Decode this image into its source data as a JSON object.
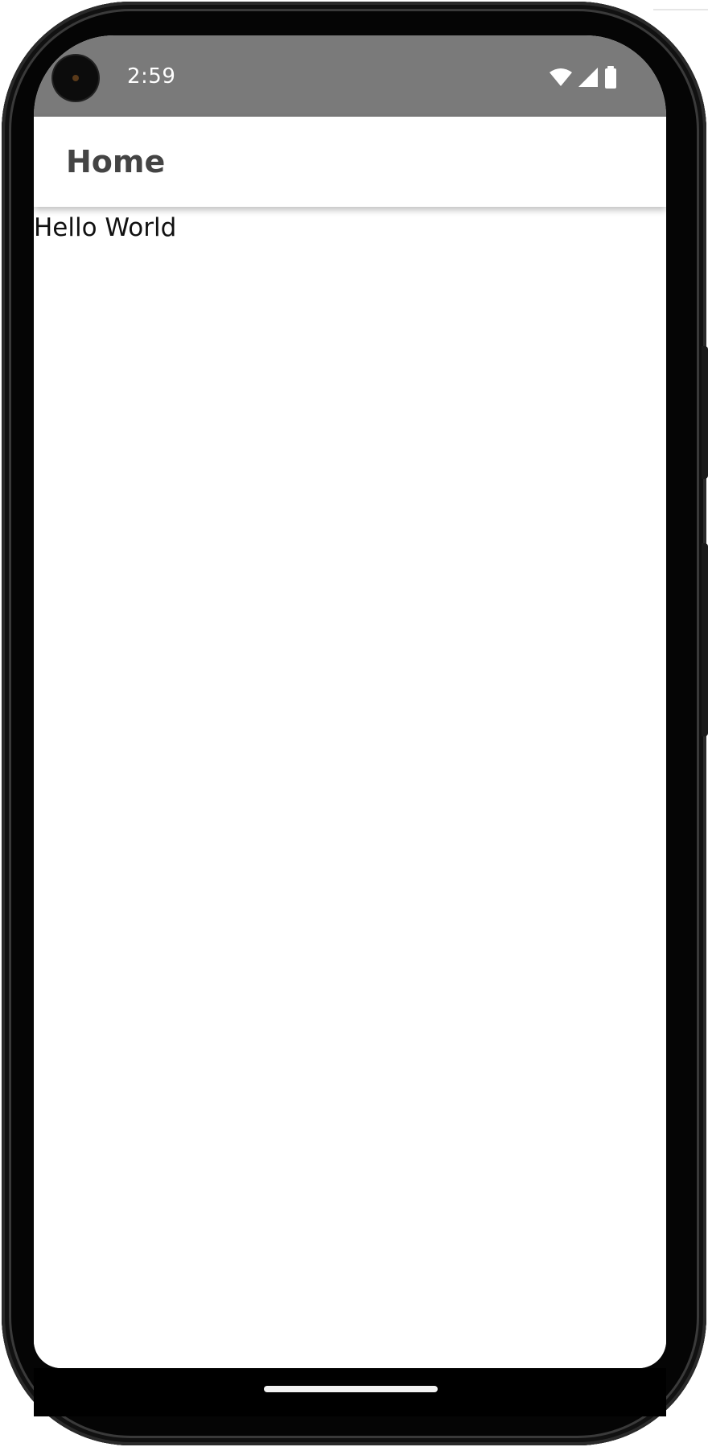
{
  "status_bar": {
    "time": "2:59",
    "icons": [
      "wifi-icon",
      "cellular-signal-icon",
      "battery-icon"
    ]
  },
  "app_bar": {
    "title": "Home"
  },
  "content": {
    "text": "Hello World"
  },
  "colors": {
    "status_bar_bg": "#7a7a7a",
    "app_bar_bg": "#ffffff",
    "title_text": "#444444",
    "phone_frame": "#050505"
  }
}
